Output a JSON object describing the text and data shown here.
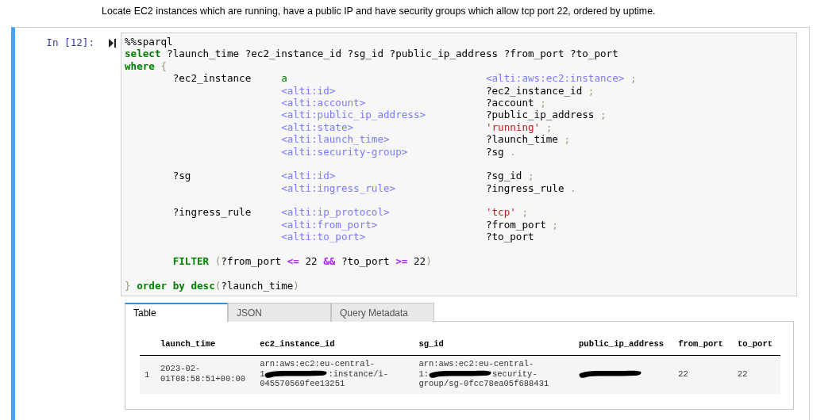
{
  "description": "Locate EC2 instances which are running, have a public IP and have security groups which allow tcp port 22, ordered by uptime.",
  "cell": {
    "prompt": "In [12]:",
    "code": [
      {
        "kind": "text",
        "tokens": [
          {
            "kind": "plain",
            "text": "%%sparql"
          }
        ]
      },
      {
        "kind": "text",
        "tokens": [
          {
            "kind": "keyword",
            "text": "select"
          },
          {
            "kind": "plain",
            "text": " ?launch_time ?ec2_instance_id ?sg_id ?public_ip_address ?from_port ?to_port"
          }
        ]
      },
      {
        "kind": "text",
        "tokens": [
          {
            "kind": "keyword",
            "text": "where"
          },
          {
            "kind": "punct",
            "text": " {"
          }
        ]
      },
      {
        "kind": "triple",
        "subject": "?ec2_instance",
        "predicate": {
          "kind": "atom",
          "text": "a"
        },
        "object": {
          "kind": "iri",
          "text": "<alti:aws:ec2:instance>"
        },
        "end": ";"
      },
      {
        "kind": "triple",
        "predicate": {
          "kind": "iri",
          "text": "<alti:id>"
        },
        "object": {
          "kind": "plain",
          "text": "?ec2_instance_id"
        },
        "end": ";"
      },
      {
        "kind": "triple",
        "predicate": {
          "kind": "iri",
          "text": "<alti:account>"
        },
        "object": {
          "kind": "plain",
          "text": "?account"
        },
        "end": ";"
      },
      {
        "kind": "triple",
        "predicate": {
          "kind": "iri",
          "text": "<alti:public_ip_address>"
        },
        "object": {
          "kind": "plain",
          "text": "?public_ip_address"
        },
        "end": ";"
      },
      {
        "kind": "triple",
        "predicate": {
          "kind": "iri",
          "text": "<alti:state>"
        },
        "object": {
          "kind": "string",
          "text": "'running'"
        },
        "end": ";"
      },
      {
        "kind": "triple",
        "predicate": {
          "kind": "iri",
          "text": "<alti:launch_time>"
        },
        "object": {
          "kind": "plain",
          "text": "?launch_time"
        },
        "end": ";"
      },
      {
        "kind": "triple",
        "predicate": {
          "kind": "iri",
          "text": "<alti:security-group>"
        },
        "object": {
          "kind": "plain",
          "text": "?sg"
        },
        "end": "."
      },
      {
        "kind": "blank"
      },
      {
        "kind": "triple",
        "subject": "?sg",
        "predicate": {
          "kind": "iri",
          "text": "<alti:id>"
        },
        "object": {
          "kind": "plain",
          "text": "?sg_id"
        },
        "end": ";"
      },
      {
        "kind": "triple",
        "predicate": {
          "kind": "iri",
          "text": "<alti:ingress_rule>"
        },
        "object": {
          "kind": "plain",
          "text": "?ingress_rule"
        },
        "end": "."
      },
      {
        "kind": "blank"
      },
      {
        "kind": "triple",
        "subject": "?ingress_rule",
        "predicate": {
          "kind": "iri",
          "text": "<alti:ip_protocol>"
        },
        "object": {
          "kind": "string",
          "text": "'tcp'"
        },
        "end": ";"
      },
      {
        "kind": "triple",
        "predicate": {
          "kind": "iri",
          "text": "<alti:from_port>"
        },
        "object": {
          "kind": "plain",
          "text": "?from_port"
        },
        "end": ";"
      },
      {
        "kind": "triple",
        "predicate": {
          "kind": "iri",
          "text": "<alti:to_port>"
        },
        "object": {
          "kind": "plain",
          "text": "?to_port"
        }
      },
      {
        "kind": "blank"
      },
      {
        "kind": "indented",
        "tokens": [
          {
            "kind": "keyword",
            "text": "FILTER"
          },
          {
            "kind": "punct",
            "text": " ("
          },
          {
            "kind": "plain",
            "text": "?from_port "
          },
          {
            "kind": "op",
            "text": "<="
          },
          {
            "kind": "plain",
            "text": " 22 "
          },
          {
            "kind": "op",
            "text": "&&"
          },
          {
            "kind": "plain",
            "text": " ?to_port "
          },
          {
            "kind": "op",
            "text": ">="
          },
          {
            "kind": "plain",
            "text": " 22"
          },
          {
            "kind": "punct",
            "text": ")"
          }
        ]
      },
      {
        "kind": "blank"
      },
      {
        "kind": "text",
        "tokens": [
          {
            "kind": "punct",
            "text": "}"
          },
          {
            "kind": "keyword",
            "text": " order by desc"
          },
          {
            "kind": "punct",
            "text": "("
          },
          {
            "kind": "plain",
            "text": "?launch_time"
          },
          {
            "kind": "punct",
            "text": ")"
          }
        ]
      }
    ]
  },
  "tabs": [
    {
      "label": "Table",
      "selected": true
    },
    {
      "label": "JSON",
      "selected": false
    },
    {
      "label": "Query Metadata",
      "selected": false
    }
  ],
  "table": {
    "columns": [
      "launch_time",
      "ec2_instance_id",
      "sg_id",
      "public_ip_address",
      "from_port",
      "to_port"
    ],
    "rows": [
      {
        "index": "1",
        "cells": [
          {
            "lines": [
              [
                {
                  "kind": "text",
                  "text": "2023-02-"
                }
              ],
              [
                {
                  "kind": "text",
                  "text": "01T08:58:51+00:00"
                }
              ]
            ]
          },
          {
            "lines": [
              [
                {
                  "kind": "text",
                  "text": "arn:aws:ec2:eu-central-"
                }
              ],
              [
                {
                  "kind": "text",
                  "text": "1"
                },
                {
                  "kind": "redaction"
                },
                {
                  "kind": "text",
                  "text": ":instance/i-"
                }
              ],
              [
                {
                  "kind": "text",
                  "text": "045570569fee13251"
                }
              ]
            ]
          },
          {
            "lines": [
              [
                {
                  "kind": "text",
                  "text": "arn:aws:ec2:eu-central-"
                }
              ],
              [
                {
                  "kind": "text",
                  "text": "1:"
                },
                {
                  "kind": "redaction"
                },
                {
                  "kind": "text",
                  "text": "security-"
                }
              ],
              [
                {
                  "kind": "text",
                  "text": "group/sg-0fcc78ea05f688431"
                }
              ]
            ]
          },
          {
            "lines": [
              [
                {
                  "kind": "redaction"
                }
              ]
            ]
          },
          {
            "lines": [
              [
                {
                  "kind": "text",
                  "text": "22"
                }
              ]
            ]
          },
          {
            "lines": [
              [
                {
                  "kind": "text",
                  "text": "22"
                }
              ]
            ]
          }
        ]
      }
    ]
  }
}
